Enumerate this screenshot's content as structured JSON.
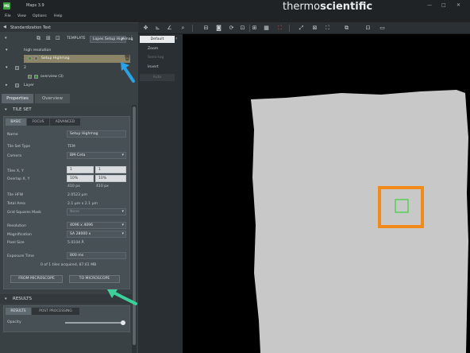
{
  "app": {
    "title": "Maps 3.9",
    "brand_light": "thermo",
    "brand_bold": "scientific",
    "logo_text": "MS"
  },
  "menu": [
    "File",
    "View",
    "Options",
    "Help"
  ],
  "window_controls": {
    "minimize": "—",
    "maximize": "□",
    "close": "✕"
  },
  "layers": {
    "header": "Standardization Text",
    "template_label": "TEMPLATE",
    "template_value": "Lopes Setup Highmag",
    "items": [
      {
        "label": "high resolution",
        "level": 0
      },
      {
        "label": "Setup Highmag",
        "level": 1,
        "selected": true
      },
      {
        "label": "2",
        "level": 0
      },
      {
        "label": "overview (3)",
        "level": 1
      },
      {
        "label": "Layer",
        "level": 0
      }
    ]
  },
  "panel_tabs": {
    "properties": "Properties",
    "overview": "Overview"
  },
  "tile_set": {
    "section": "TILE SET",
    "subtabs": [
      "BASIC",
      "FOCUS",
      "ADVANCED"
    ],
    "name_label": "Name",
    "name_value": "Setup Highmag",
    "type_label": "Tile Set Type",
    "type_value": "TEM",
    "camera_label": "Camera",
    "camera_value": "BM-Ceta",
    "tiles_label": "Tiles X, Y",
    "tiles_x": "1",
    "tiles_y": "1",
    "overlap_label": "Overlap X, Y",
    "overlap_x": "10%",
    "overlap_y": "10%",
    "px_x": "410 px",
    "px_y": "410 px",
    "hfw_label": "Tile HFW",
    "hfw_value": "2.0523 µm",
    "area_label": "Total Area",
    "area_value": "2.1 µm x 2.1 µm",
    "grid_label": "Grid Squares Mask",
    "grid_value": "None",
    "resolution_label": "Resolution",
    "resolution_value": "4096 x 4096",
    "mag_label": "Magnification",
    "mag_value": "SA 28000 x",
    "pixel_label": "Pixel Size",
    "pixel_value": "5.0104 Å",
    "exposure_label": "Exposure Time",
    "exposure_value": "800 ms",
    "acquired": "0 of 1 tiles acquired, 87.61 MB",
    "from_btn": "FROM MICROSCOPE",
    "to_btn": "TO MICROSCOPE"
  },
  "results": {
    "section": "RESULTS",
    "subtabs": [
      "RESULTS",
      "POST PROCESSING"
    ],
    "opacity_label": "Opacity",
    "opacity": 1.0
  },
  "view_panel": {
    "default": "Default",
    "zoom": "Zoom",
    "semilog": "Semi-log",
    "invert": "Invert",
    "auto": "Auto"
  },
  "colors": {
    "highlight_tile": "#f28a1a",
    "inner_tile": "#3bd23b",
    "arrow_blue": "#2aa2e6",
    "arrow_green": "#3cd19a",
    "sample": "#c9c9c9"
  }
}
